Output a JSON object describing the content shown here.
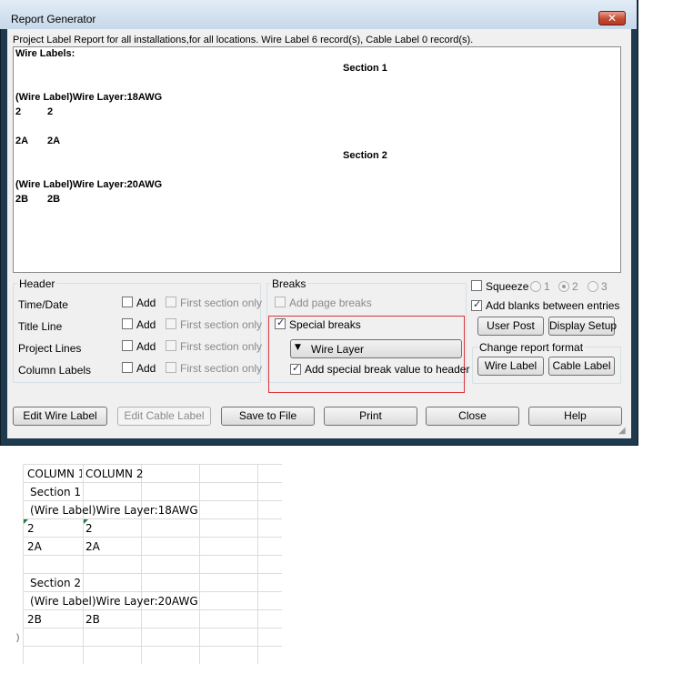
{
  "window": {
    "title": "Report Generator",
    "close_glyph": "✕",
    "resize_glyph": "◢"
  },
  "summary": "Project Label Report for all installations,for all locations. Wire Label 6 record(s), Cable Label 0 record(s).",
  "report": {
    "heading": "Wire Labels:",
    "section1": "Section 1",
    "layer1": "(Wire Label)Wire Layer:18AWG",
    "row1": [
      "2",
      "2"
    ],
    "row2": [
      "2A",
      "2A"
    ],
    "section2": "Section 2",
    "layer2": "(Wire Label)Wire Layer:20AWG",
    "row3": [
      "2B",
      "2B"
    ]
  },
  "header_group": {
    "title": "Header",
    "rows": [
      {
        "label": "Time/Date",
        "add": "Add",
        "first": "First section only"
      },
      {
        "label": "Title Line",
        "add": "Add",
        "first": "First section only"
      },
      {
        "label": "Project Lines",
        "add": "Add",
        "first": "First section only"
      },
      {
        "label": "Column Labels",
        "add": "Add",
        "first": "First section only"
      }
    ]
  },
  "breaks_group": {
    "title": "Breaks",
    "add_page_breaks": "Add page breaks",
    "special_breaks": "Special breaks",
    "special_breaks_checked": true,
    "break_type": "Wire Layer",
    "add_value_to_header": "Add special break value to header",
    "add_value_checked": true,
    "check_glyph": "✓",
    "dropdown_glyph": "▼"
  },
  "options": {
    "squeeze": "Squeeze",
    "squeeze_options": [
      "1",
      "2",
      "3"
    ],
    "squeeze_selected": "2",
    "add_blanks": "Add blanks between entries",
    "add_blanks_checked": true,
    "user_post": "User Post",
    "display_setup": "Display Setup",
    "change_format_title": "Change report format",
    "wire_label": "Wire Label",
    "cable_label": "Cable Label"
  },
  "buttons": {
    "edit_wire_label": "Edit Wire Label",
    "edit_cable_label": "Edit Cable Label",
    "save_to_file": "Save to File",
    "print": "Print",
    "close": "Close",
    "help": "Help"
  },
  "spreadsheet": {
    "headers": [
      "COLUMN 1",
      "COLUMN 2"
    ],
    "section1": "Section 1",
    "layer1": "(Wire Label)Wire Layer:18AWG",
    "row1": [
      "2",
      "2"
    ],
    "row2": [
      "2A",
      "2A"
    ],
    "section2": "Section 2",
    "layer2": "(Wire Label)Wire Layer:20AWG",
    "row3": [
      "2B",
      "2B"
    ],
    "edge_mark": ")"
  }
}
